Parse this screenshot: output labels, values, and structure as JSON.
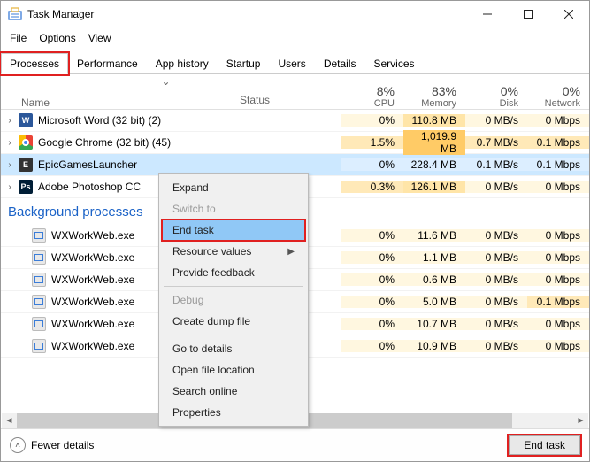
{
  "window": {
    "title": "Task Manager"
  },
  "menubar": {
    "file": "File",
    "options": "Options",
    "view": "View"
  },
  "tabs": [
    "Processes",
    "Performance",
    "App history",
    "Startup",
    "Users",
    "Details",
    "Services"
  ],
  "columns": {
    "name": "Name",
    "status": "Status",
    "cpu": {
      "pct": "8%",
      "label": "CPU"
    },
    "memory": {
      "pct": "83%",
      "label": "Memory"
    },
    "disk": {
      "pct": "0%",
      "label": "Disk"
    },
    "network": {
      "pct": "0%",
      "label": "Network"
    }
  },
  "apps": [
    {
      "name": "Microsoft Word (32 bit) (2)",
      "cpu": "0%",
      "mem": "110.8 MB",
      "disk": "0 MB/s",
      "net": "0 Mbps",
      "cpu_bg": "bg-cpu-0",
      "mem_bg": "bg-mem-med",
      "disk_bg": "bg-disk-0",
      "net_bg": "bg-net-0"
    },
    {
      "name": "Google Chrome (32 bit) (45)",
      "cpu": "1.5%",
      "mem": "1,019.9 MB",
      "disk": "0.7 MB/s",
      "net": "0.1 Mbps",
      "cpu_bg": "bg-cpu-1",
      "mem_bg": "bg-mem-high",
      "disk_bg": "bg-disk-1",
      "net_bg": "bg-net-1"
    },
    {
      "name": "EpicGamesLauncher",
      "cpu": "0%",
      "mem": "228.4 MB",
      "disk": "0.1 MB/s",
      "net": "0.1 Mbps"
    },
    {
      "name": "Adobe Photoshop CC",
      "cpu": "0.3%",
      "mem": "126.1 MB",
      "disk": "0 MB/s",
      "net": "0 Mbps",
      "cpu_bg": "bg-cpu-1",
      "mem_bg": "bg-mem-med",
      "disk_bg": "bg-disk-0",
      "net_bg": "bg-net-0"
    }
  ],
  "section": "Background processes",
  "bg_procs": [
    {
      "name": "WXWorkWeb.exe",
      "cpu": "0%",
      "mem": "11.6 MB",
      "disk": "0 MB/s",
      "net": "0 Mbps",
      "mem_bg": "bg-mem-low"
    },
    {
      "name": "WXWorkWeb.exe",
      "cpu": "0%",
      "mem": "1.1 MB",
      "disk": "0 MB/s",
      "net": "0 Mbps",
      "mem_bg": "bg-mem-low"
    },
    {
      "name": "WXWorkWeb.exe",
      "cpu": "0%",
      "mem": "0.6 MB",
      "disk": "0 MB/s",
      "net": "0 Mbps",
      "mem_bg": "bg-mem-low"
    },
    {
      "name": "WXWorkWeb.exe",
      "cpu": "0%",
      "mem": "5.0 MB",
      "disk": "0 MB/s",
      "net": "0.1 Mbps",
      "mem_bg": "bg-mem-low",
      "net_bg": "bg-net-1"
    },
    {
      "name": "WXWorkWeb.exe",
      "cpu": "0%",
      "mem": "10.7 MB",
      "disk": "0 MB/s",
      "net": "0 Mbps",
      "mem_bg": "bg-mem-low"
    },
    {
      "name": "WXWorkWeb.exe",
      "cpu": "0%",
      "mem": "10.9 MB",
      "disk": "0 MB/s",
      "net": "0 Mbps",
      "mem_bg": "bg-mem-low"
    }
  ],
  "context_menu": {
    "expand": "Expand",
    "switch_to": "Switch to",
    "end_task": "End task",
    "resource_values": "Resource values",
    "provide_feedback": "Provide feedback",
    "debug": "Debug",
    "create_dump": "Create dump file",
    "go_details": "Go to details",
    "open_location": "Open file location",
    "search_online": "Search online",
    "properties": "Properties"
  },
  "footer": {
    "fewer": "Fewer details",
    "end_task": "End task"
  }
}
